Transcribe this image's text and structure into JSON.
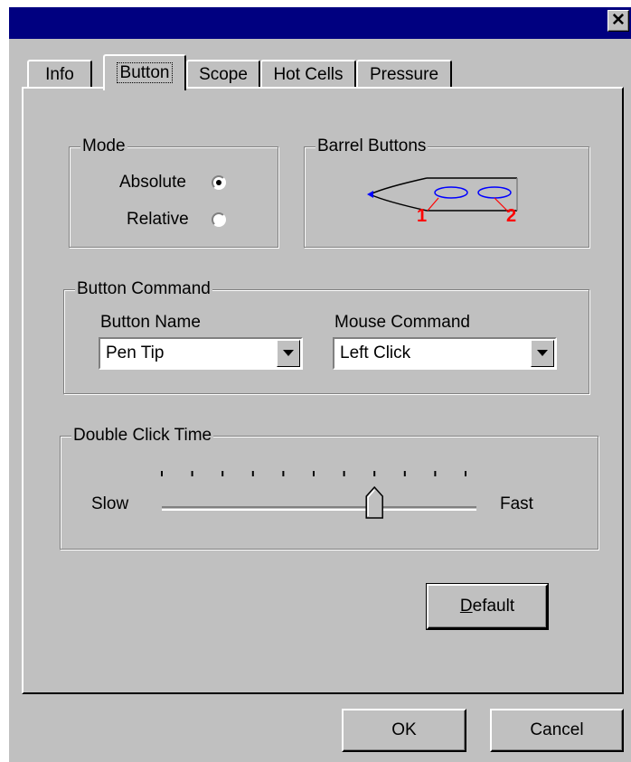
{
  "window": {
    "title": "",
    "close_glyph": "✕"
  },
  "tabs": [
    {
      "label": "Info",
      "active": false
    },
    {
      "label": "Button",
      "active": true
    },
    {
      "label": "Scope",
      "active": false
    },
    {
      "label": "Hot Cells",
      "active": false
    },
    {
      "label": "Pressure",
      "active": false
    }
  ],
  "mode": {
    "legend": "Mode",
    "options": [
      {
        "label": "Absolute",
        "selected": true
      },
      {
        "label": "Relative",
        "selected": false
      }
    ]
  },
  "barrel": {
    "legend": "Barrel Buttons",
    "label_1": "1",
    "label_2": "2",
    "colors": {
      "outline": "#0000ff",
      "label": "#ff0000"
    }
  },
  "button_command": {
    "legend": "Button Command",
    "button_name_label": "Button Name",
    "button_name_value": "Pen Tip",
    "mouse_command_label": "Mouse Command",
    "mouse_command_value": "Left Click"
  },
  "double_click": {
    "legend": "Double Click Time",
    "slow_label": "Slow",
    "fast_label": "Fast",
    "tick_count": 11,
    "slider_position": 0.7
  },
  "buttons": {
    "default_label_first": "D",
    "default_label_rest": "efault",
    "ok_label": "OK",
    "cancel_label": "Cancel"
  },
  "colors": {
    "face": "#c0c0c0",
    "title_bar": "#000080"
  }
}
